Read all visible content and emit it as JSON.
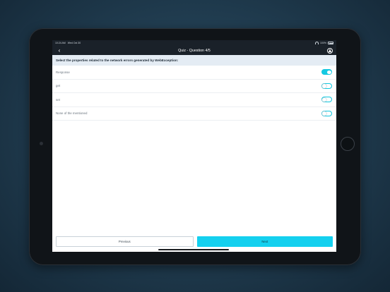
{
  "status_bar": {
    "time": "10:24 AM",
    "date": "Wed Oct 30",
    "battery": "100%"
  },
  "nav": {
    "title": "Quiz - Question 4/5",
    "back_icon": "chevron-left-icon",
    "profile_icon": "user-circle-icon"
  },
  "question": {
    "text": "Select the properties related to the network errors generated by WebException:"
  },
  "options": [
    {
      "label": "Response",
      "selected": true
    },
    {
      "label": "get",
      "selected": false
    },
    {
      "label": "set",
      "selected": false
    },
    {
      "label": "None of the mentioned",
      "selected": false
    }
  ],
  "footer": {
    "previous_label": "Previous",
    "next_label": "Next"
  },
  "colors": {
    "accent": "#14d0ef",
    "nav_bg": "#1a2129",
    "question_bg": "#e4ecf4"
  }
}
